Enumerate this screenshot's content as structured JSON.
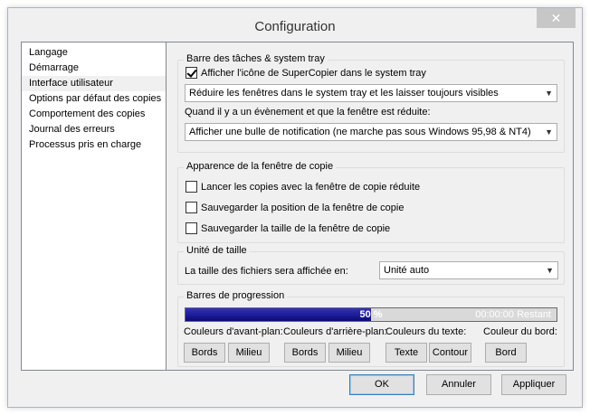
{
  "window": {
    "title": "Configuration",
    "close_glyph": "✕"
  },
  "sidebar": {
    "items": [
      {
        "label": "Langage"
      },
      {
        "label": "Démarrage"
      },
      {
        "label": "Interface utilisateur"
      },
      {
        "label": "Options par défaut des copies"
      },
      {
        "label": "Comportement des copies"
      },
      {
        "label": "Journal des erreurs"
      },
      {
        "label": "Processus pris en charge"
      }
    ],
    "selected_index": 2
  },
  "taskbar_group": {
    "title": "Barre des tâches & system tray",
    "show_icon_label": "Afficher l'icône de SuperCopier dans le system tray",
    "show_icon_checked": true,
    "minimize_select": "Réduire les fenêtres dans le system tray et les laisser toujours visibles",
    "event_label": "Quand il y a un évènement et que la fenêtre est réduite:",
    "event_select": "Afficher une bulle de notification (ne marche pas sous Windows 95,98 & NT4)"
  },
  "appearance_group": {
    "title": "Apparence de la fenêtre de copie",
    "options": [
      {
        "label": "Lancer les copies avec la fenêtre de copie réduite",
        "checked": false
      },
      {
        "label": "Sauvegarder la position de la fenêtre de copie",
        "checked": false
      },
      {
        "label": "Sauvegarder la taille de la fenêtre de copie",
        "checked": false
      }
    ]
  },
  "size_group": {
    "title": "Unité de taille",
    "label": "La taille des fichiers sera affichée en:",
    "select": "Unité auto"
  },
  "progress_group": {
    "title": "Barres de progression",
    "progress_value": 0.5,
    "progress_text": "50 %",
    "time_text": "00:00:00 Restant",
    "colors": {
      "fill_dark": "#0a0a78",
      "fill_light": "#3232b8",
      "track": "#d9d9d9"
    },
    "foreground_label": "Couleurs d'avant-plan:",
    "background_label": "Couleurs d'arrière-plan:",
    "text_label": "Couleurs du texte:",
    "border_label": "Couleur du bord:",
    "fg_edges": "Bords",
    "fg_middle": "Milieu",
    "bg_edges": "Bords",
    "bg_middle": "Milieu",
    "text_text": "Texte",
    "text_outline": "Contour",
    "border_edge": "Bord"
  },
  "footer": {
    "ok": "OK",
    "cancel": "Annuler",
    "apply": "Appliquer"
  }
}
